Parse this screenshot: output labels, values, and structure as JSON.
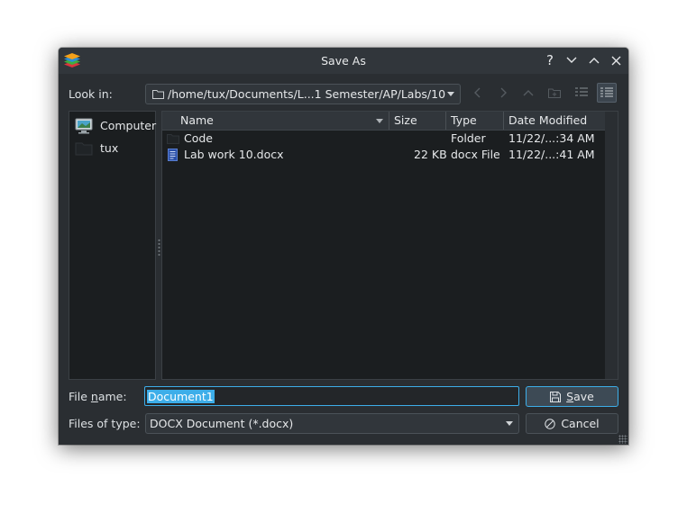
{
  "window": {
    "title": "Save As"
  },
  "titlebar": {
    "help_label": "?"
  },
  "look_in": {
    "label": "Look in:",
    "path": "/home/tux/Documents/L...1 Semester/AP/Labs/10"
  },
  "places": [
    {
      "label": "Computer",
      "icon": "computer-icon"
    },
    {
      "label": "tux",
      "icon": "home-folder-icon"
    }
  ],
  "file_list": {
    "columns": [
      "Name",
      "Size",
      "Type",
      "Date Modified"
    ],
    "rows": [
      {
        "name": "Code",
        "size": "",
        "type": "Folder",
        "date": "11/22/...:34 AM",
        "icon": "folder-icon"
      },
      {
        "name": "Lab work 10.docx",
        "size": "22 KB",
        "type": "docx File",
        "date": "11/22/...:41 AM",
        "icon": "document-icon"
      }
    ]
  },
  "file_name": {
    "label_pre": "File ",
    "label_mn": "n",
    "label_post": "ame:",
    "value": "Document1"
  },
  "file_type": {
    "label": "Files of type:",
    "value": "DOCX Document (*.docx)"
  },
  "buttons": {
    "save_mn": "S",
    "save_rest": "ave",
    "cancel": "Cancel"
  },
  "colors": {
    "accent": "#3daee9",
    "window_bg": "#2a2e32",
    "view_bg": "#1b1e20"
  }
}
